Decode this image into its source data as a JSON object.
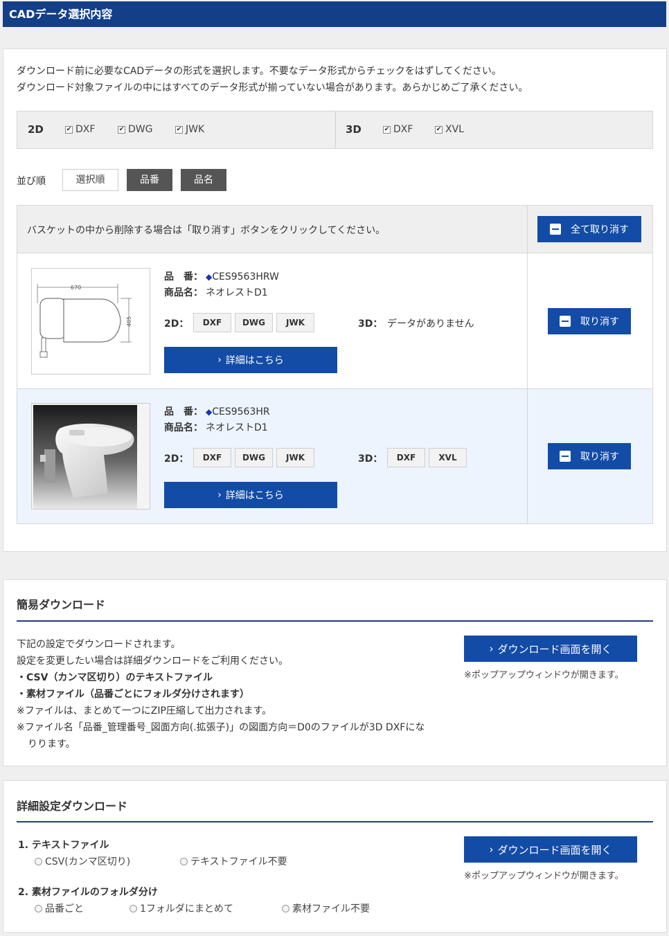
{
  "header": {
    "title": "CADデータ選択内容"
  },
  "intro": {
    "line1": "ダウンロード前に必要なCADデータの形式を選択します。不要なデータ形式からチェックをはずしてください。",
    "line2": "ダウンロード対象ファイルの中にはすべてのデータ形式が揃っていない場合があります。あらかじめご了承ください。"
  },
  "formats": {
    "d2": {
      "label": "2D",
      "options": [
        {
          "label": "DXF",
          "checked": true
        },
        {
          "label": "DWG",
          "checked": true
        },
        {
          "label": "JWK",
          "checked": true
        }
      ]
    },
    "d3": {
      "label": "3D",
      "options": [
        {
          "label": "DXF",
          "checked": true
        },
        {
          "label": "XVL",
          "checked": true
        }
      ]
    }
  },
  "sort": {
    "label": "並び順",
    "options": [
      "選択順",
      "品番",
      "品名"
    ],
    "selected": "選択順"
  },
  "basket": {
    "instruction": "バスケットの中から削除する場合は「取り消す」ボタンをクリックしてください。",
    "clear_all_label": "全て取り消す",
    "cancel_label": "取り消す",
    "part_label": "品　番：",
    "name_label": "商品名：",
    "d2_label": "2D：",
    "d3_label": "3D：",
    "detail_label": "詳細はこちら",
    "items": [
      {
        "part_no": "CES9563HRW",
        "name": "ネオレストD1",
        "d2": [
          "DXF",
          "DWG",
          "JWK"
        ],
        "d3": [],
        "d3_none": "データがありません",
        "image": "drawing"
      },
      {
        "part_no": "CES9563HR",
        "name": "ネオレストD1",
        "d2": [
          "DXF",
          "DWG",
          "JWK"
        ],
        "d3": [
          "DXF",
          "XVL"
        ],
        "d3_none": "",
        "image": "photo"
      }
    ],
    "drawing_dims": {
      "width": "670",
      "depth": "405"
    }
  },
  "easy": {
    "title": "簡易ダウンロード",
    "line1": "下記の設定でダウンロードされます。",
    "line2": "設定を変更したい場合は詳細ダウンロードをご利用ください。",
    "bold1": "・CSV（カンマ区切り）のテキストファイル",
    "bold2": "・素材ファイル（品番ごとにフォルダ分けされます）",
    "note1": "※ファイルは、まとめて一つにZIP圧縮して出力されます。",
    "note2a": "※ファイル名「品番_管理番号_図面方向(.拡張子)」の図面方向＝D0のファイルが3D DXFにな",
    "note2b": "りります。",
    "button_label": "ダウンロード画面を開く",
    "popup_note": "※ポップアップウィンドウが開きます。"
  },
  "detail": {
    "title": "詳細設定ダウンロード",
    "q1_label": "1. テキストファイル",
    "q1_options": [
      "CSV(カンマ区切り)",
      "テキストファイル不要"
    ],
    "q2_label": "2. 素材ファイルのフォルダ分け",
    "q2_options": [
      "品番ごと",
      "1フォルダにまとめて",
      "素材ファイル不要"
    ],
    "button_label": "ダウンロード画面を開く",
    "popup_note": "※ポップアップウィンドウが開きます。"
  }
}
